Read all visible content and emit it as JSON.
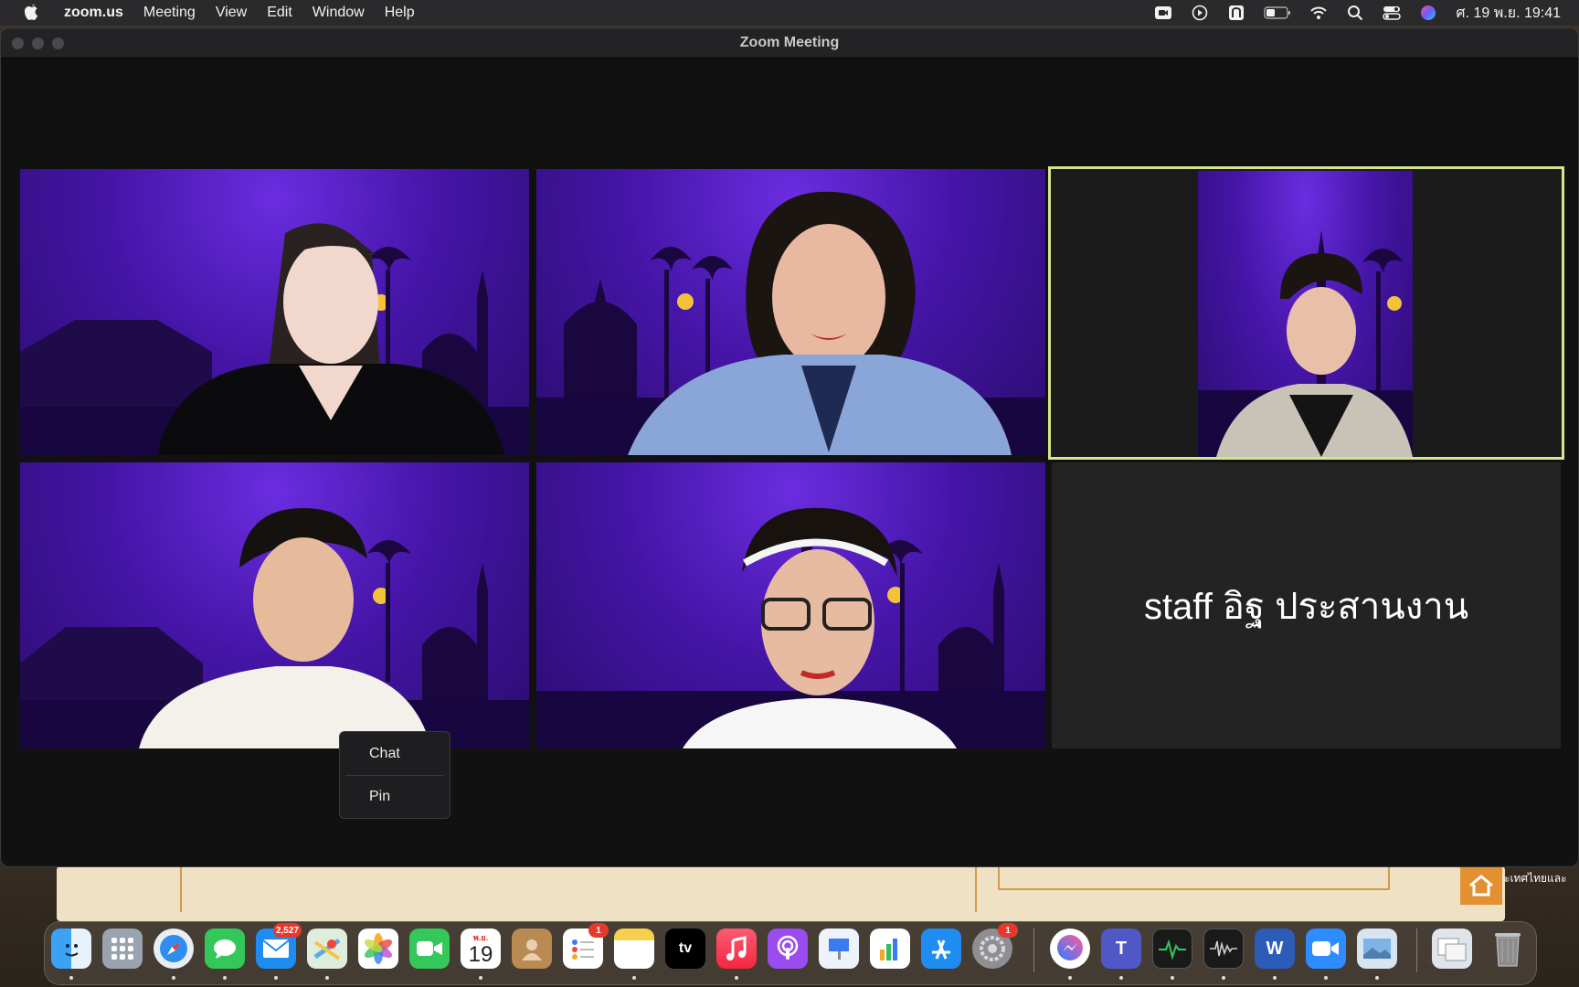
{
  "menubar": {
    "app_name": "zoom.us",
    "menus": [
      "Meeting",
      "View",
      "Edit",
      "Window",
      "Help"
    ],
    "status_icons": [
      "zoom-camera-icon",
      "play-circle-icon",
      "keyboard-input-thai-icon",
      "battery-icon",
      "wifi-icon",
      "spotlight-search-icon",
      "control-center-icon",
      "siri-icon"
    ],
    "clock": "ศ. 19 พ.ย. 19:41"
  },
  "window": {
    "title": "Zoom Meeting"
  },
  "meeting": {
    "active_speaker_color": "#d6e58f",
    "video_off_participant": "staff อิฐ ประสานงาน"
  },
  "context_menu": {
    "items": [
      "Chat",
      "Pin"
    ]
  },
  "background": {
    "partial_text": "ะเทศไทยและ"
  },
  "dock": {
    "mail_badge": "2,527",
    "calendar_month": "พ.ย.",
    "calendar_day": "19",
    "reminders_badge": "1",
    "settings_badge": "1",
    "tv_label": "tv",
    "word_label": "W",
    "teams_label": "T"
  }
}
